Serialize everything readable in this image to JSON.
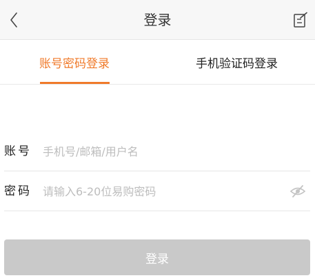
{
  "header": {
    "title": "登录",
    "back_icon": "chevron-left-icon",
    "edit_icon": "edit-note-icon"
  },
  "tabs": [
    {
      "label": "账号密码登录",
      "active": true
    },
    {
      "label": "手机验证码登录",
      "active": false
    }
  ],
  "form": {
    "account": {
      "label": "账号",
      "value": "",
      "placeholder": "手机号/邮箱/用户名"
    },
    "password": {
      "label": "密码",
      "value": "",
      "placeholder": "请输入6-20位易购密码",
      "toggle_icon": "eye-hidden-icon"
    }
  },
  "login_button": {
    "label": "登录",
    "enabled": false
  },
  "colors": {
    "accent": "#f07a2a",
    "header_bg": "#f7f7f7",
    "button_disabled": "#c9c9c9",
    "placeholder": "#bdbdbd"
  }
}
